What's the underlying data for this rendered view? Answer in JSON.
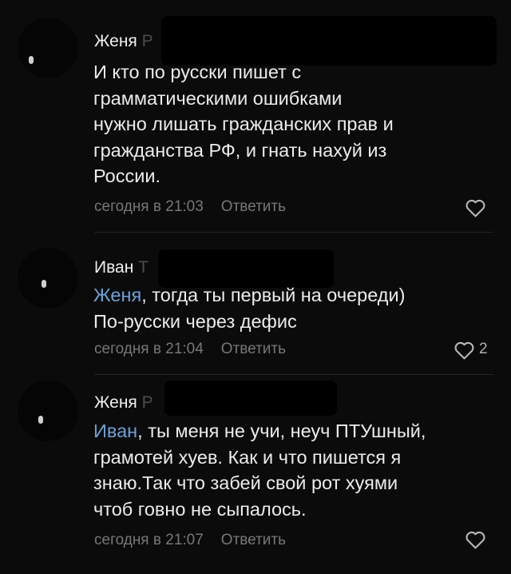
{
  "comments": [
    {
      "author": "Женя",
      "author_suffix": "Р",
      "text_lines": [
        "И кто по русски пишет с",
        "грамматическими ошибками",
        "нужно лишать гражданских прав и",
        "гражданства РФ, и гнать нахуй из",
        "России."
      ],
      "time": "сегодня в 21:03",
      "reply_label": "Ответить",
      "likes": ""
    },
    {
      "author": "Иван",
      "author_suffix": "Т",
      "mention": "Женя",
      "text_lines": [
        ", тогда ты первый на очереди)",
        "По-русски через дефис"
      ],
      "time": "сегодня в 21:04",
      "reply_label": "Ответить",
      "likes": "2"
    },
    {
      "author": "Женя",
      "author_suffix": "Р",
      "mention": "Иван",
      "text_lines": [
        ", ты меня не учи, неуч ПТУшный,",
        "грамотей хуев. Как и что пишется я",
        "знаю.Так что забей свой рот хуями",
        "чтоб говно не сыпалось."
      ],
      "time": "сегодня в 21:07",
      "reply_label": "Ответить",
      "likes": ""
    }
  ],
  "icons": {
    "like": "heart-outline-icon"
  },
  "colors": {
    "background": "#0b0b0b",
    "mention": "#6fa0d6",
    "meta": "#777777",
    "text": "#ececec"
  }
}
